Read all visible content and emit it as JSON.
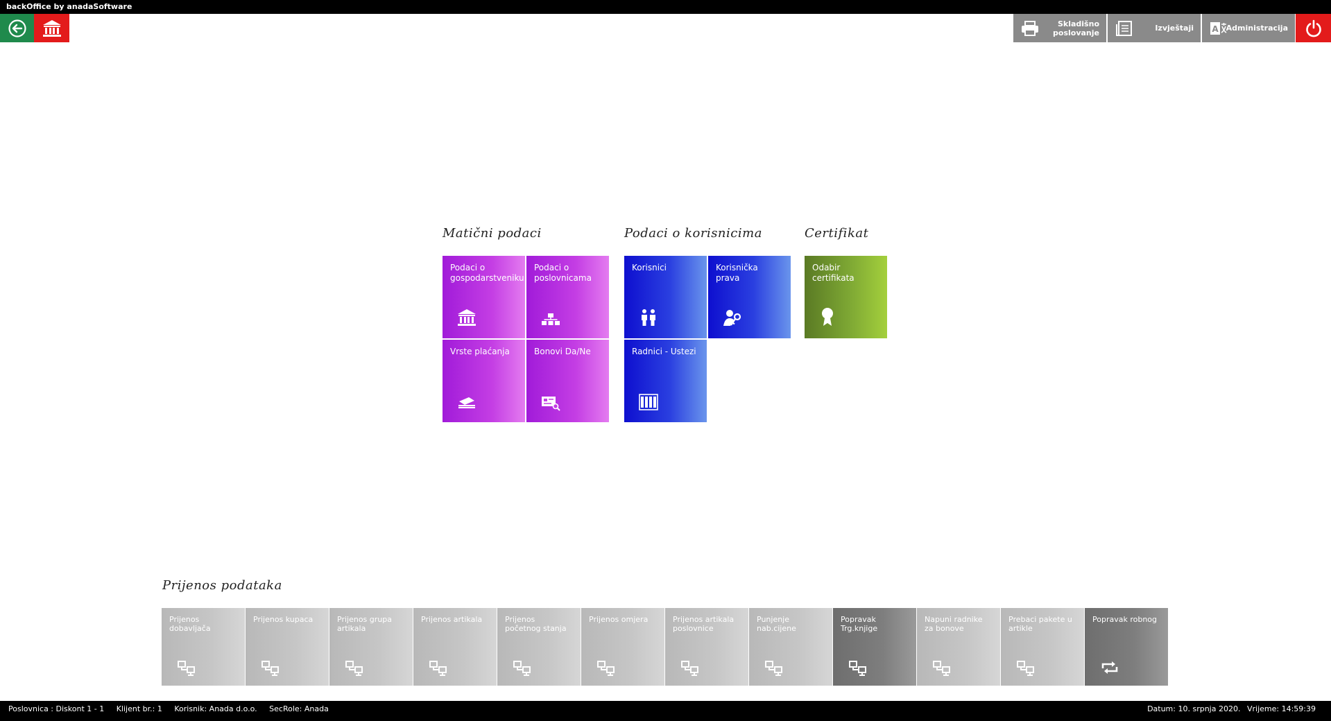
{
  "window": {
    "title": "backOffice by anadaSoftware"
  },
  "toolbar": {
    "back_icon": "back-arrow-icon",
    "home_icon": "bank-icon",
    "buttons": [
      {
        "label_line1": "Skladišno",
        "label_line2": "poslovanje",
        "icon": "printer-icon"
      },
      {
        "label_line1": "Izvještaji",
        "label_line2": "",
        "icon": "report-icon"
      },
      {
        "label_line1": "Administracija",
        "label_line2": "",
        "icon": "admin-icon"
      }
    ],
    "power_icon": "power-icon"
  },
  "groups": {
    "maticni": {
      "title": "Matični podaci",
      "tiles": [
        {
          "label": "Podaci o gospodarstveniku",
          "icon": "bank-icon"
        },
        {
          "label": "Podaci o poslovnicama",
          "icon": "hierarchy-icon"
        },
        {
          "label": "Vrste plaćanja",
          "icon": "payment-icon"
        },
        {
          "label": "Bonovi Da/Ne",
          "icon": "voucher-search-icon"
        }
      ]
    },
    "korisnici": {
      "title": "Podaci o korisnicima",
      "tiles": [
        {
          "label": "Korisnici",
          "icon": "users-icon"
        },
        {
          "label": "Korisnička prava",
          "icon": "user-key-icon"
        },
        {
          "label": "Radnici - Ustezi",
          "icon": "workers-icon"
        }
      ]
    },
    "certifikat": {
      "title": "Certifikat",
      "tiles": [
        {
          "label": "Odabir certifikata",
          "icon": "certificate-icon"
        }
      ]
    },
    "prijenos": {
      "title": "Prijenos podataka",
      "tiles": [
        {
          "label": "Prijenos dobavljača",
          "icon": "network-icon"
        },
        {
          "label": "Prijenos kupaca",
          "icon": "network-icon"
        },
        {
          "label": "Prijenos grupa artikala",
          "icon": "network-icon"
        },
        {
          "label": "Prijenos artikala",
          "icon": "network-icon"
        },
        {
          "label": "Prijenos početnog stanja",
          "icon": "network-icon"
        },
        {
          "label": "Prijenos omjera",
          "icon": "network-icon"
        },
        {
          "label": "Prijenos artikala poslovnice",
          "icon": "network-icon"
        },
        {
          "label": "Punjenje nab.cijene",
          "icon": "network-icon"
        },
        {
          "label": "Popravak Trg.knjige",
          "icon": "network-icon"
        },
        {
          "label": "Napuni radnike za bonove",
          "icon": "network-icon"
        },
        {
          "label": "Prebaci pakete u artikle",
          "icon": "network-icon"
        },
        {
          "label": "Popravak robnog",
          "icon": "refresh-icon"
        }
      ]
    }
  },
  "status": {
    "poslovnica": "Poslovnica : Diskont 1 - 1",
    "klijent": "Klijent br.: 1",
    "korisnik": "Korisnik: Anada d.o.o.",
    "secrole": "SecRole: Anada",
    "datum": "Datum: 10. srpnja 2020.",
    "vrijeme": "Vrijeme: 14:59:39"
  }
}
